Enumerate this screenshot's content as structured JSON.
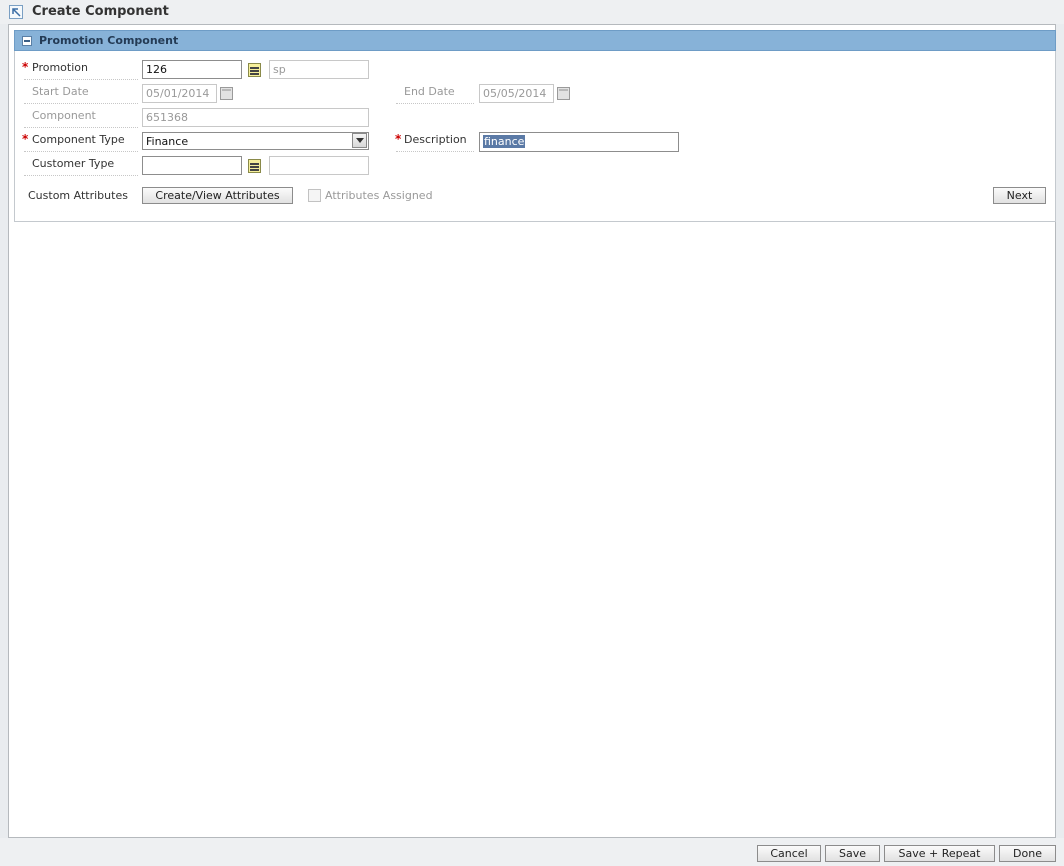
{
  "window": {
    "title": "Create Component"
  },
  "section": {
    "title": "Promotion Component"
  },
  "form": {
    "promotion": {
      "label": "Promotion",
      "value": "126",
      "description": "sp"
    },
    "start_date": {
      "label": "Start Date",
      "value": "05/01/2014"
    },
    "end_date": {
      "label": "End Date",
      "value": "05/05/2014"
    },
    "component": {
      "label": "Component",
      "value": "651368"
    },
    "component_type": {
      "label": "Component Type",
      "selected": "Finance"
    },
    "description": {
      "label": "Description",
      "value": "finance"
    },
    "customer_type": {
      "label": "Customer Type",
      "value": "",
      "description": ""
    },
    "custom_attributes": {
      "label": "Custom Attributes",
      "button": "Create/View Attributes",
      "assigned_label": "Attributes Assigned",
      "assigned_checked": false
    }
  },
  "buttons": {
    "next": "Next",
    "cancel": "Cancel",
    "save": "Save",
    "save_repeat": "Save + Repeat",
    "done": "Done"
  },
  "icons": {
    "title": "maximize-icon",
    "collapse": "collapse-icon",
    "lov": "list-of-values-icon",
    "calendar": "calendar-icon",
    "dropdown": "chevron-down-icon"
  },
  "colors": {
    "section_header": "#87b2d8",
    "required": "#cc0000",
    "selection": "#5b7aa6"
  }
}
